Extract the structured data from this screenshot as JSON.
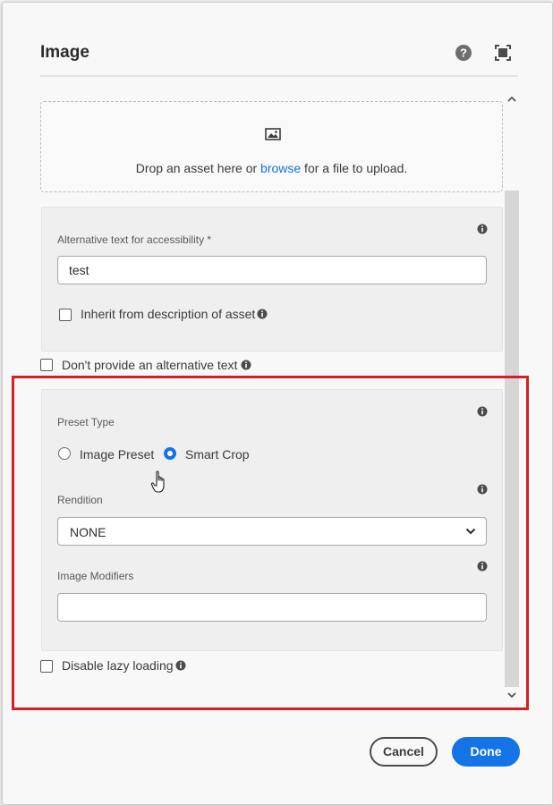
{
  "dialog": {
    "title": "Image",
    "icons": {
      "help": "help-icon",
      "fullscreen": "fullscreen-icon"
    }
  },
  "dropzone": {
    "text_before": "Drop an asset here or ",
    "link": "browse",
    "text_after": " for a file to upload."
  },
  "alt_text": {
    "label": "Alternative text for accessibility *",
    "value": "test",
    "inherit_label": "Inherit from description of asset",
    "inherit_checked": false
  },
  "no_alt": {
    "label": "Don't provide an alternative text",
    "checked": false
  },
  "preset": {
    "label": "Preset Type",
    "options": [
      {
        "label": "Image Preset",
        "selected": false
      },
      {
        "label": "Smart Crop",
        "selected": true
      }
    ]
  },
  "rendition": {
    "label": "Rendition",
    "value": "NONE"
  },
  "modifiers": {
    "label": "Image Modifiers",
    "value": ""
  },
  "lazy_loading": {
    "label": "Disable lazy loading",
    "checked": false
  },
  "buttons": {
    "cancel": "Cancel",
    "done": "Done"
  },
  "colors": {
    "accent": "#1473e6",
    "highlight": "#d61e26"
  }
}
